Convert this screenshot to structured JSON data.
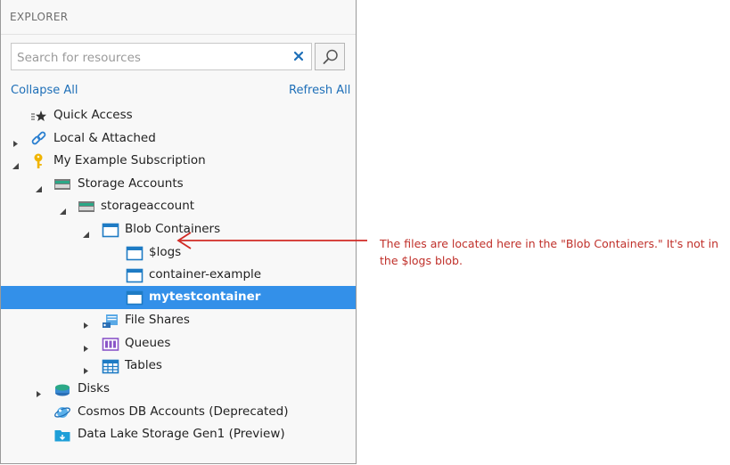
{
  "explorer": {
    "title": "EXPLORER",
    "search": {
      "placeholder": "Search for resources",
      "value": ""
    },
    "actions": {
      "collapse_all": "Collapse All",
      "refresh_all": "Refresh All"
    },
    "tree": {
      "quick_access": "Quick Access",
      "local_attached": "Local & Attached",
      "subscription": "My Example Subscription",
      "storage_accounts": "Storage Accounts",
      "storageaccount": "storageaccount",
      "blob_containers": "Blob Containers",
      "logs": "$logs",
      "container_example": "container-example",
      "mytestcontainer": "mytestcontainer",
      "file_shares": "File Shares",
      "queues": "Queues",
      "tables": "Tables",
      "disks": "Disks",
      "cosmos": "Cosmos DB Accounts (Deprecated)",
      "data_lake": "Data Lake Storage Gen1 (Preview)"
    },
    "selected_item": "mytestcontainer"
  },
  "annotation": {
    "text": "The files are located here in the \"Blob Containers.\" It's not in the $logs blob.",
    "color": "#c0302a"
  },
  "colors": {
    "selection": "#3390e9",
    "link": "#1e6fb8",
    "blob_icon": "#1e7bc4"
  },
  "icons": {
    "quick_access": "star-icon",
    "local_attached": "link-icon",
    "subscription": "key-icon",
    "storage": "storage-account-icon",
    "container": "blob-container-icon",
    "file_shares": "file-share-icon",
    "queues": "queue-icon",
    "tables": "table-icon",
    "disks": "disk-icon",
    "cosmos": "cosmos-db-icon",
    "data_lake": "data-lake-icon"
  }
}
